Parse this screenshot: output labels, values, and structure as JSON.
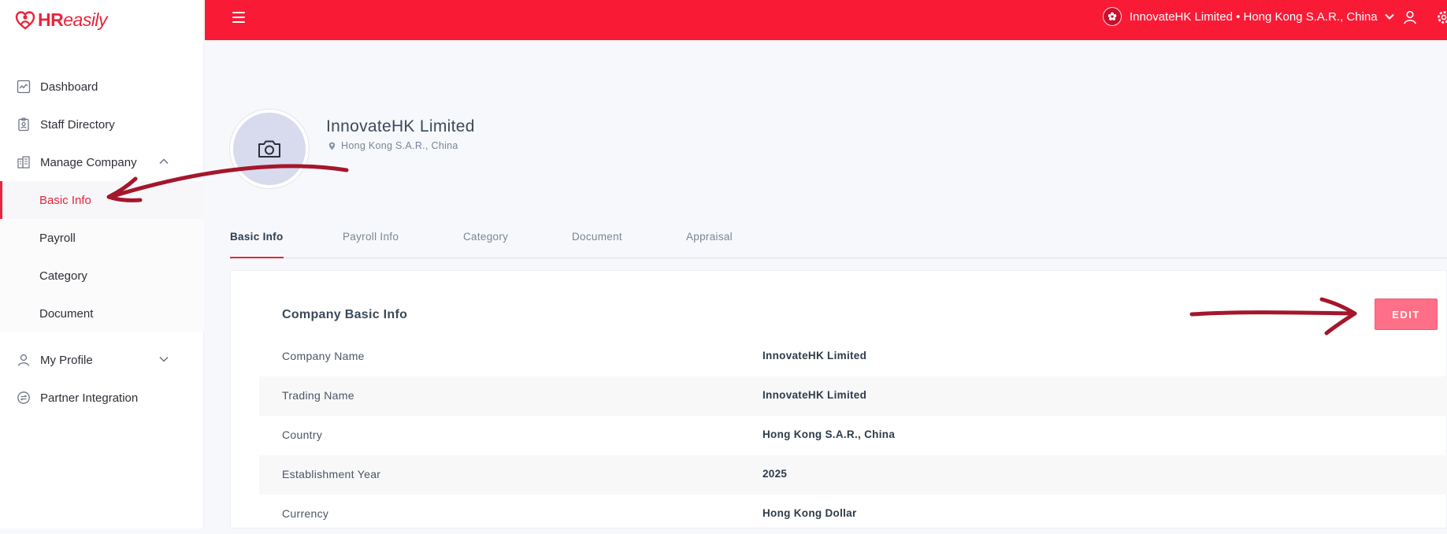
{
  "brand": {
    "logo_main": "HR",
    "logo_rest": "easily"
  },
  "sidebar": {
    "items": [
      {
        "label": "Dashboard",
        "icon": "chart-icon"
      },
      {
        "label": "Staff Directory",
        "icon": "id-badge-icon"
      },
      {
        "label": "Manage Company",
        "icon": "building-icon",
        "expanded": true,
        "children": [
          {
            "label": "Basic Info",
            "active": true
          },
          {
            "label": "Payroll"
          },
          {
            "label": "Category"
          },
          {
            "label": "Document"
          }
        ]
      },
      {
        "label": "My Profile",
        "icon": "user-icon",
        "expanded": false
      },
      {
        "label": "Partner Integration",
        "icon": "integration-icon"
      }
    ]
  },
  "header": {
    "company_switch": "InnovateHK Limited • Hong Kong S.A.R., China",
    "bg_color": "#f91b36"
  },
  "profile": {
    "name": "InnovateHK Limited",
    "location": "Hong Kong S.A.R., China"
  },
  "tabs": [
    {
      "label": "Basic Info",
      "active": true
    },
    {
      "label": "Payroll Info"
    },
    {
      "label": "Category"
    },
    {
      "label": "Document"
    },
    {
      "label": "Appraisal"
    }
  ],
  "card": {
    "title": "Company Basic Info",
    "edit_label": "EDIT",
    "rows": [
      {
        "label": "Company Name",
        "value": "InnovateHK Limited"
      },
      {
        "label": "Trading Name",
        "value": "InnovateHK Limited"
      },
      {
        "label": "Country",
        "value": "Hong Kong S.A.R., China"
      },
      {
        "label": "Establishment Year",
        "value": "2025"
      },
      {
        "label": "Currency",
        "value": "Hong Kong Dollar"
      }
    ]
  },
  "colors": {
    "accent": "#e8253b",
    "edit_button": "#ff6f87",
    "annotation": "#a5162b"
  }
}
